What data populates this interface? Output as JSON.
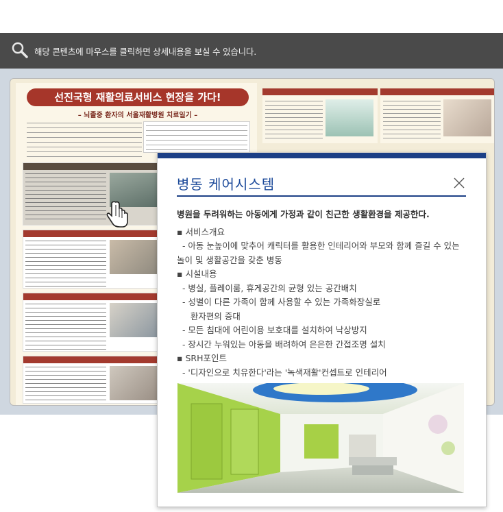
{
  "topbar": {
    "hint_text": "해당 콘텐츠에 마우스를 클릭하면 상세내용을 보실 수 있습니다.",
    "icon": "magnifier-icon"
  },
  "paper": {
    "headline": "선진국형 재활의료서비스 현장을 가다!",
    "subhead": "– 뇌졸중 환자의 서울재활병원 치료일기 –"
  },
  "modal": {
    "title": "병동 케어시스템",
    "close_icon": "close-icon",
    "lede": "병원을 두려워하는 아동에게 가정과 같이 친근한 생활환경을 제공한다.",
    "items": [
      "▪ 서비스개요",
      "  - 아동 눈높이에 맞추어 캐릭터를 활용한 인테리어와 부모와 함께 즐길 수 있는 놀이 및 생활공간을 갖춘 병동",
      "▪ 시설내용",
      "  - 병실, 플레이룸, 휴게공간의 균형 있는 공간배치",
      "  - 성별이 다른 가족이 함께 사용할 수 있는 가족화장실로",
      "     환자편의 증대",
      "  - 모든 침대에 어린이용 보호대를 설치하여 낙상방지",
      "  - 장시간 누워있는 아동을 배려하여 은은한 간접조명 설치",
      "▪ SRH포인트",
      "  - '디자인으로 치유한다'라는 '녹색재활'컨셉트로 인테리어"
    ],
    "photo_alt": "어린이 병동 복도 사진"
  },
  "colors": {
    "topbar": "#4a4a4a",
    "modal_accent": "#1c3f86",
    "headline_red": "#a6362a"
  }
}
